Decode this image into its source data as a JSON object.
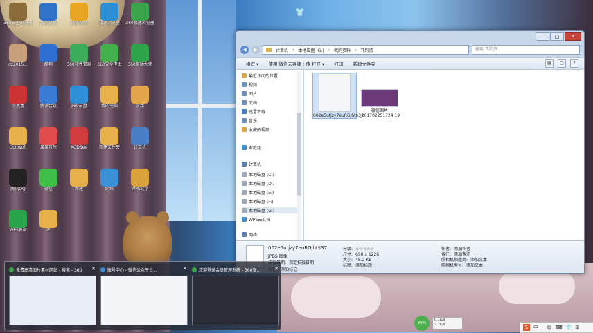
{
  "desktop": {
    "icons": [
      {
        "label": "360安全浏览器",
        "color": "#8c6b3a"
      },
      {
        "label": "我的文档",
        "color": "#2f73c9"
      },
      {
        "label": "腾讯视频",
        "color": "#e8a623"
      },
      {
        "label": "极速浏览器",
        "color": "#2c8fd6"
      },
      {
        "label": "360极速浏览器",
        "color": "#3aa44a"
      },
      {
        "label": "dz2015...",
        "color": "#c7a07a"
      },
      {
        "label": "酷狗",
        "color": "#2f6fd1"
      },
      {
        "label": "360软件管家",
        "color": "#3cab5a"
      },
      {
        "label": "360安全卫士",
        "color": "#43b04c"
      },
      {
        "label": "360驱动大师",
        "color": "#2fa54a"
      },
      {
        "label": "小黑盒",
        "color": "#c33"
      },
      {
        "label": "腾讯会议",
        "color": "#3a7bd5"
      },
      {
        "label": "360云盘",
        "color": "#2e8fd6"
      },
      {
        "label": "我的电脑",
        "color": "#e7b04a"
      },
      {
        "label": "游戏",
        "color": "#e4a64a"
      },
      {
        "label": "Ocrosoft",
        "color": "#e7b04a"
      },
      {
        "label": "果果音乐",
        "color": "#e24b4b"
      },
      {
        "label": "ACDSee",
        "color": "#d23b3b"
      },
      {
        "label": "新建文件夹",
        "color": "#e7b04a"
      },
      {
        "label": "计算机",
        "color": "#4a7fc7"
      },
      {
        "label": "腾讯QQ",
        "color": "#222"
      },
      {
        "label": "微信",
        "color": "#3fbf48"
      },
      {
        "label": "新建",
        "color": "#e7b04a"
      },
      {
        "label": "网络",
        "color": "#3a8fd6"
      },
      {
        "label": "WPS文字",
        "color": "#d9a23a"
      },
      {
        "label": "WPS表格",
        "color": "#2aa44a"
      },
      {
        "label": "IE",
        "color": "#e7b04a"
      }
    ]
  },
  "explorer": {
    "window_controls": {
      "minimize": "—",
      "maximize": "□",
      "close": "✕"
    },
    "breadcrumb": [
      "计算机",
      "本地磁盘 (G:)",
      "我的资料",
      "飞豹资"
    ],
    "search_placeholder": "搜索 飞豹资",
    "toolbar": {
      "organize": "组织 ▾",
      "open_with": "使用 微信云存储上传 打开 ▾",
      "print": "打印",
      "new_folder": "新建文件夹"
    },
    "nav": [
      {
        "label": "最近访问的位置",
        "color": "#e0a23a",
        "selected": false
      },
      {
        "label": "视频",
        "color": "#6a8fc7",
        "selected": false
      },
      {
        "label": "图片",
        "color": "#6a8fc7",
        "selected": false
      },
      {
        "label": "文档",
        "color": "#6a8fc7",
        "selected": false
      },
      {
        "label": "迅雷下载",
        "color": "#3a7fd5",
        "selected": false
      },
      {
        "label": "音乐",
        "color": "#6a8fc7",
        "selected": false
      },
      {
        "label": "收藏的视频",
        "color": "#e0a23a",
        "selected": false
      },
      {
        "label": "家庭组",
        "color": "#3a8fd6",
        "selected": false
      },
      {
        "label": "计算机",
        "color": "#5a7fb6",
        "selected": false
      },
      {
        "label": "本地磁盘 (C:)",
        "color": "#9aa8b8",
        "selected": false
      },
      {
        "label": "本地磁盘 (D:)",
        "color": "#9aa8b8",
        "selected": false
      },
      {
        "label": "本地磁盘 (E:)",
        "color": "#9aa8b8",
        "selected": false
      },
      {
        "label": "本地磁盘 (F:)",
        "color": "#9aa8b8",
        "selected": false
      },
      {
        "label": "本地磁盘 (G:)",
        "color": "#9aa8b8",
        "selected": true
      },
      {
        "label": "WPS云文档",
        "color": "#3a8fd6",
        "selected": false
      },
      {
        "label": "网络",
        "color": "#5a7fb6",
        "selected": false
      }
    ],
    "files": [
      {
        "name": "002e5utjzy7euRGjht$37",
        "selected": true,
        "thumb_color": "#f5f6f8"
      },
      {
        "name": "微信图片_201702251724 19",
        "selected": false,
        "thumb_color": "#6a3a7a"
      }
    ],
    "details": {
      "name": "002e5utjzy7euRGjht$37",
      "type": "JPEG 图像",
      "rows": [
        {
          "label": "拍摄日期:",
          "value": "指定拍摄日期"
        },
        {
          "label": "标记:",
          "value": "添加标记"
        },
        {
          "label": "分级:",
          "value": "☆☆☆☆☆"
        },
        {
          "label": "尺寸:",
          "value": "690 x 1226"
        },
        {
          "label": "大小:",
          "value": "48.2 KB"
        },
        {
          "label": "标题:",
          "value": "添加标题"
        },
        {
          "label": "作者:",
          "value": "添加作者"
        },
        {
          "label": "备注:",
          "value": "添加备注"
        },
        {
          "label": "照相机制造商:",
          "value": "添加文本"
        },
        {
          "label": "照相机型号:",
          "value": "添加文本"
        }
      ]
    }
  },
  "taskbar_previews": [
    {
      "title": "免费高清图片素材网站 - 搜索 - 360",
      "icon_color": "#3aa44a",
      "preview_color": "#e9eef4"
    },
    {
      "title": "账号中心 - 微信公众平台...",
      "icon_color": "#3a8fd6",
      "preview_color": "#f2f4f8"
    },
    {
      "title": "欢迎登录会员管理系统 - 360安...",
      "icon_color": "#3aa44a",
      "preview_color": "#2a2d38"
    }
  ],
  "tray": {
    "gauge": "39%",
    "up_speed": "0.1K/s",
    "down_speed": "2.7K/s",
    "ime_items": [
      "S",
      "中",
      "·",
      "☺",
      "⌨",
      "👕",
      "⊞"
    ]
  }
}
